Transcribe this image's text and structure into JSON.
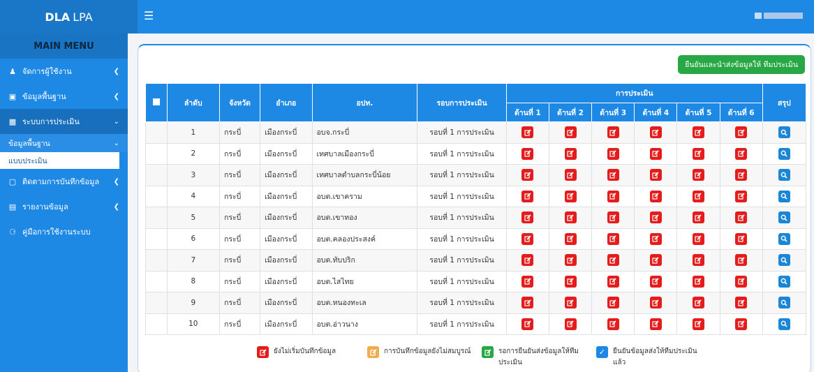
{
  "brand": {
    "bold": "DLA",
    "light": "LPA"
  },
  "header": {
    "menu_icon": "hamburger-icon"
  },
  "sidebar": {
    "title": "MAIN MENU",
    "items": [
      {
        "label": "จัดการผู้ใช้งาน",
        "icon": "user-icon"
      },
      {
        "label": "ข้อมูลพื้นฐาน",
        "icon": "info-icon"
      },
      {
        "label": "ระบบการประเมิน",
        "icon": "document-icon"
      },
      {
        "label": "ติดตามการบันทึกข้อมูล",
        "icon": "clipboard-icon"
      },
      {
        "label": "รายงานข้อมูล",
        "icon": "chart-icon"
      },
      {
        "label": "คู่มือการใช้งานระบบ",
        "icon": "help-icon"
      }
    ],
    "sub_head": "ข้อมูลพื้นฐาน",
    "sub_item": "แบบประเมิน"
  },
  "toolbar": {
    "confirm_label": "ยืนยันและนำส่งข้อมูลให้ ทีมประเมิน"
  },
  "table": {
    "group_header": "การประเมิน",
    "headers": {
      "no": "ลำดับ",
      "province": "จังหวัด",
      "district": "อำเภอ",
      "org": "อปท.",
      "round": "รอบการประเมิน",
      "summary": "สรุป"
    },
    "aspects": [
      "ด้านที่ 1",
      "ด้านที่ 2",
      "ด้านที่ 3",
      "ด้านที่ 4",
      "ด้านที่ 5",
      "ด้านที่ 6"
    ],
    "rows": [
      {
        "no": "1",
        "province": "กระบี่",
        "district": "เมืองกระบี่",
        "org": "อบจ.กระบี่",
        "round": "รอบที่ 1 การประเมิน"
      },
      {
        "no": "2",
        "province": "กระบี่",
        "district": "เมืองกระบี่",
        "org": "เทศบาลเมืองกระบี่",
        "round": "รอบที่ 1 การประเมิน"
      },
      {
        "no": "3",
        "province": "กระบี่",
        "district": "เมืองกระบี่",
        "org": "เทศบาลตำบลกระบี่น้อย",
        "round": "รอบที่ 1 การประเมิน"
      },
      {
        "no": "4",
        "province": "กระบี่",
        "district": "เมืองกระบี่",
        "org": "อบต.เขาคราม",
        "round": "รอบที่ 1 การประเมิน"
      },
      {
        "no": "5",
        "province": "กระบี่",
        "district": "เมืองกระบี่",
        "org": "อบต.เขาทอง",
        "round": "รอบที่ 1 การประเมิน"
      },
      {
        "no": "6",
        "province": "กระบี่",
        "district": "เมืองกระบี่",
        "org": "อบต.คลองประสงค์",
        "round": "รอบที่ 1 การประเมิน"
      },
      {
        "no": "7",
        "province": "กระบี่",
        "district": "เมืองกระบี่",
        "org": "อบต.ทับปริก",
        "round": "รอบที่ 1 การประเมิน"
      },
      {
        "no": "8",
        "province": "กระบี่",
        "district": "เมืองกระบี่",
        "org": "อบต.ไสไทย",
        "round": "รอบที่ 1 การประเมิน"
      },
      {
        "no": "9",
        "province": "กระบี่",
        "district": "เมืองกระบี่",
        "org": "อบต.หนองทะเล",
        "round": "รอบที่ 1 การประเมิน"
      },
      {
        "no": "10",
        "province": "กระบี่",
        "district": "เมืองกระบี่",
        "org": "อบต.อ่าวนาง",
        "round": "รอบที่ 1 การประเมิน"
      }
    ]
  },
  "legend": [
    {
      "label": "ยังไม่เริ่มบันทึกข้อมูล",
      "color": "#e41c1c"
    },
    {
      "label": "การบันทึกข้อมูลยังไม่สมบูรณ์",
      "color": "#f0ad4e"
    },
    {
      "label": "รอการยืนยันส่งข้อมูลให้ทีมประเมิน",
      "color": "#28a745"
    },
    {
      "label": "ยืนยันข้อมูลส่งให้ทีมประเมินแล้ว",
      "color": "#1e88e5"
    }
  ]
}
